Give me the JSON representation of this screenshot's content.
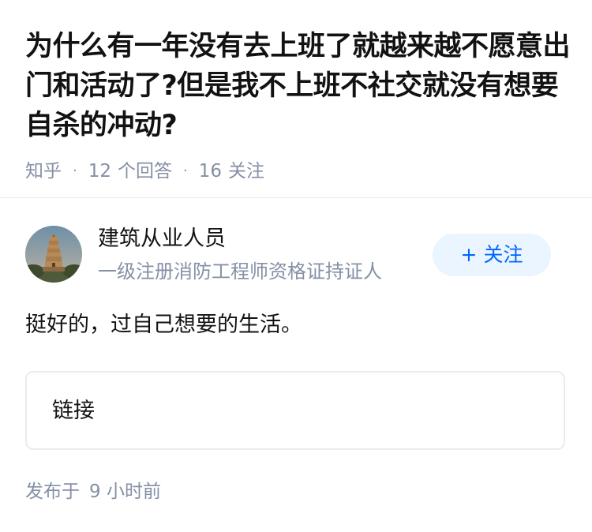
{
  "question": {
    "title": "为什么有一年没有去上班了就越来越不愿意出门和活动了?但是我不上班不社交就没有想要自杀的冲动?",
    "source": "知乎",
    "answers_count": "12",
    "answers_label": "个回答",
    "followers_count": "16",
    "followers_label": "关注"
  },
  "author": {
    "name": "建筑从业人员",
    "description": "一级注册消防工程师资格证持证人",
    "follow_label": "+ 关注",
    "avatar_icon": "pagoda-avatar-icon"
  },
  "answer": {
    "text": "挺好的，过自己想要的生活。",
    "link_label": "链接",
    "published_prefix": "发布于",
    "published_time": "9 小时前"
  },
  "colors": {
    "primary_text": "#121212",
    "meta_text": "#8590a6",
    "accent": "#0066ff",
    "follow_bg": "#ebf5ff",
    "border": "#ebebeb"
  }
}
